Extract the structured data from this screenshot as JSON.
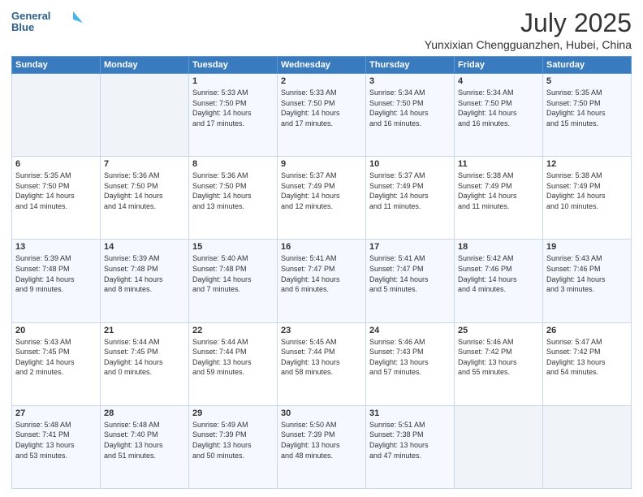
{
  "header": {
    "logo_line1": "General",
    "logo_line2": "Blue",
    "month_title": "July 2025",
    "location": "Yunxixian Chengguanzhen, Hubei, China"
  },
  "weekdays": [
    "Sunday",
    "Monday",
    "Tuesday",
    "Wednesday",
    "Thursday",
    "Friday",
    "Saturday"
  ],
  "weeks": [
    [
      {
        "day": "",
        "info": ""
      },
      {
        "day": "",
        "info": ""
      },
      {
        "day": "1",
        "info": "Sunrise: 5:33 AM\nSunset: 7:50 PM\nDaylight: 14 hours\nand 17 minutes."
      },
      {
        "day": "2",
        "info": "Sunrise: 5:33 AM\nSunset: 7:50 PM\nDaylight: 14 hours\nand 17 minutes."
      },
      {
        "day": "3",
        "info": "Sunrise: 5:34 AM\nSunset: 7:50 PM\nDaylight: 14 hours\nand 16 minutes."
      },
      {
        "day": "4",
        "info": "Sunrise: 5:34 AM\nSunset: 7:50 PM\nDaylight: 14 hours\nand 16 minutes."
      },
      {
        "day": "5",
        "info": "Sunrise: 5:35 AM\nSunset: 7:50 PM\nDaylight: 14 hours\nand 15 minutes."
      }
    ],
    [
      {
        "day": "6",
        "info": "Sunrise: 5:35 AM\nSunset: 7:50 PM\nDaylight: 14 hours\nand 14 minutes."
      },
      {
        "day": "7",
        "info": "Sunrise: 5:36 AM\nSunset: 7:50 PM\nDaylight: 14 hours\nand 14 minutes."
      },
      {
        "day": "8",
        "info": "Sunrise: 5:36 AM\nSunset: 7:50 PM\nDaylight: 14 hours\nand 13 minutes."
      },
      {
        "day": "9",
        "info": "Sunrise: 5:37 AM\nSunset: 7:49 PM\nDaylight: 14 hours\nand 12 minutes."
      },
      {
        "day": "10",
        "info": "Sunrise: 5:37 AM\nSunset: 7:49 PM\nDaylight: 14 hours\nand 11 minutes."
      },
      {
        "day": "11",
        "info": "Sunrise: 5:38 AM\nSunset: 7:49 PM\nDaylight: 14 hours\nand 11 minutes."
      },
      {
        "day": "12",
        "info": "Sunrise: 5:38 AM\nSunset: 7:49 PM\nDaylight: 14 hours\nand 10 minutes."
      }
    ],
    [
      {
        "day": "13",
        "info": "Sunrise: 5:39 AM\nSunset: 7:48 PM\nDaylight: 14 hours\nand 9 minutes."
      },
      {
        "day": "14",
        "info": "Sunrise: 5:39 AM\nSunset: 7:48 PM\nDaylight: 14 hours\nand 8 minutes."
      },
      {
        "day": "15",
        "info": "Sunrise: 5:40 AM\nSunset: 7:48 PM\nDaylight: 14 hours\nand 7 minutes."
      },
      {
        "day": "16",
        "info": "Sunrise: 5:41 AM\nSunset: 7:47 PM\nDaylight: 14 hours\nand 6 minutes."
      },
      {
        "day": "17",
        "info": "Sunrise: 5:41 AM\nSunset: 7:47 PM\nDaylight: 14 hours\nand 5 minutes."
      },
      {
        "day": "18",
        "info": "Sunrise: 5:42 AM\nSunset: 7:46 PM\nDaylight: 14 hours\nand 4 minutes."
      },
      {
        "day": "19",
        "info": "Sunrise: 5:43 AM\nSunset: 7:46 PM\nDaylight: 14 hours\nand 3 minutes."
      }
    ],
    [
      {
        "day": "20",
        "info": "Sunrise: 5:43 AM\nSunset: 7:45 PM\nDaylight: 14 hours\nand 2 minutes."
      },
      {
        "day": "21",
        "info": "Sunrise: 5:44 AM\nSunset: 7:45 PM\nDaylight: 14 hours\nand 0 minutes."
      },
      {
        "day": "22",
        "info": "Sunrise: 5:44 AM\nSunset: 7:44 PM\nDaylight: 13 hours\nand 59 minutes."
      },
      {
        "day": "23",
        "info": "Sunrise: 5:45 AM\nSunset: 7:44 PM\nDaylight: 13 hours\nand 58 minutes."
      },
      {
        "day": "24",
        "info": "Sunrise: 5:46 AM\nSunset: 7:43 PM\nDaylight: 13 hours\nand 57 minutes."
      },
      {
        "day": "25",
        "info": "Sunrise: 5:46 AM\nSunset: 7:42 PM\nDaylight: 13 hours\nand 55 minutes."
      },
      {
        "day": "26",
        "info": "Sunrise: 5:47 AM\nSunset: 7:42 PM\nDaylight: 13 hours\nand 54 minutes."
      }
    ],
    [
      {
        "day": "27",
        "info": "Sunrise: 5:48 AM\nSunset: 7:41 PM\nDaylight: 13 hours\nand 53 minutes."
      },
      {
        "day": "28",
        "info": "Sunrise: 5:48 AM\nSunset: 7:40 PM\nDaylight: 13 hours\nand 51 minutes."
      },
      {
        "day": "29",
        "info": "Sunrise: 5:49 AM\nSunset: 7:39 PM\nDaylight: 13 hours\nand 50 minutes."
      },
      {
        "day": "30",
        "info": "Sunrise: 5:50 AM\nSunset: 7:39 PM\nDaylight: 13 hours\nand 48 minutes."
      },
      {
        "day": "31",
        "info": "Sunrise: 5:51 AM\nSunset: 7:38 PM\nDaylight: 13 hours\nand 47 minutes."
      },
      {
        "day": "",
        "info": ""
      },
      {
        "day": "",
        "info": ""
      }
    ]
  ]
}
